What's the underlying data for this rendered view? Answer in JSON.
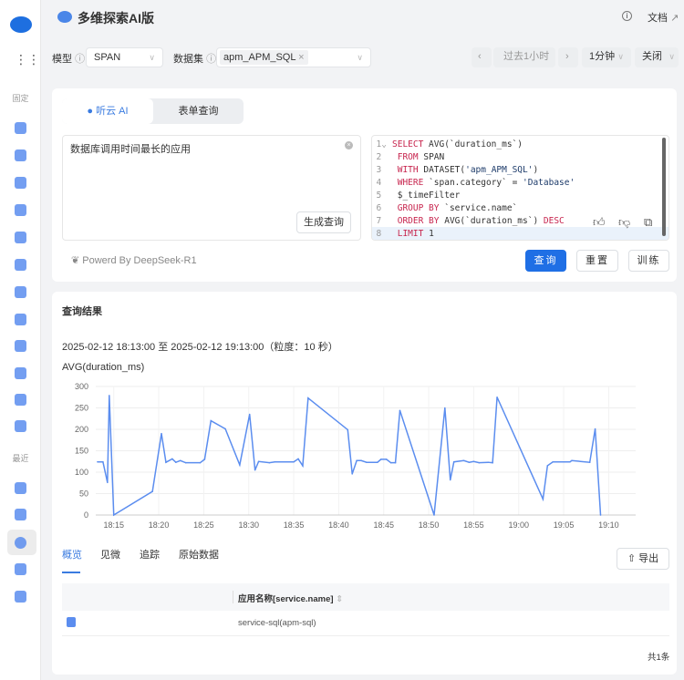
{
  "sidebar": {
    "section_pinned": "固定",
    "section_recent": "最近"
  },
  "header": {
    "title": "多维探索AI版",
    "docs": "文档"
  },
  "filters": {
    "model_label": "模型",
    "model_value": "SPAN",
    "dataset_label": "数据集",
    "dataset_tag": "apm_APM_SQL",
    "time_range": "过去1小时",
    "interval": "1分钟",
    "refresh": "关闭"
  },
  "query": {
    "tab_ai": "听云 AI",
    "tab_form": "表单查询",
    "prompt": "数据库调用时间最长的应用",
    "generate": "生成查询",
    "powered": "Powerd By DeepSeek-R1",
    "sql_lines": [
      "SELECT AVG(`duration_ms`)",
      " FROM SPAN",
      " WITH DATASET('apm_APM_SQL')",
      " WHERE `span.category` = 'Database'",
      " $_timeFilter",
      " GROUP BY `service.name`",
      " ORDER BY AVG(`duration_ms`) DESC",
      " LIMIT 1"
    ],
    "btn_query": "查询",
    "btn_reset": "重置",
    "btn_train": "训练"
  },
  "results": {
    "title": "查询结果",
    "range": "2025-02-12 18:13:00 至 2025-02-12 19:13:00（粒度：10 秒）",
    "tabs": [
      "概览",
      "见微",
      "追踪",
      "原始数据"
    ],
    "export": "导出",
    "table": {
      "header": "应用名称[service.name]",
      "rows": [
        "service-sql(apm-sql)"
      ]
    },
    "total": "共1条"
  },
  "chart_data": {
    "type": "line",
    "title": "AVG(duration_ms)",
    "xlabel": "",
    "ylabel": "",
    "ylim": [
      0,
      300
    ],
    "yticks": [
      "0",
      "50",
      "100",
      "150",
      "200",
      "250",
      "300"
    ],
    "xticks": [
      "18:15",
      "18:20",
      "18:25",
      "18:30",
      "18:35",
      "18:40",
      "18:45",
      "18:50",
      "18:55",
      "19:00",
      "19:05",
      "19:10"
    ],
    "x_unit": "minutes after 18:00",
    "xlim": [
      13,
      73
    ],
    "color": "#5b8def",
    "series": [
      {
        "name": "service-sql(apm-sql)",
        "x": [
          13.2,
          13.8,
          14.3,
          14.5,
          15,
          19.3,
          20.3,
          20.8,
          21.5,
          21.9,
          22.4,
          23,
          24.6,
          25.1,
          25.8,
          27.4,
          29,
          30.1,
          30.7,
          31.1,
          32.3,
          32.9,
          35,
          35.5,
          36,
          36.6,
          41,
          41.5,
          42,
          42.5,
          43.1,
          44.3,
          44.7,
          45.3,
          45.8,
          46.3,
          46.8,
          50.6,
          51.8,
          52.4,
          52.8,
          53.9,
          54.5,
          55,
          55.6,
          56.6,
          57.1,
          57.6,
          62.7,
          63.2,
          63.8,
          65.7,
          65.9,
          67.9,
          68.5,
          69.1
        ],
        "y": [
          124,
          124,
          76,
          279,
          0,
          55,
          190,
          123,
          131,
          123,
          127,
          122,
          122,
          130,
          220,
          201,
          117,
          235,
          105,
          125,
          122,
          124,
          124,
          131,
          115,
          273,
          199,
          96,
          127,
          127,
          123,
          123,
          130,
          130,
          122,
          122,
          244,
          0,
          250,
          82,
          124,
          127,
          123,
          125,
          122,
          123,
          122,
          275,
          37,
          115,
          124,
          124,
          127,
          123,
          201,
          0
        ]
      }
    ]
  }
}
